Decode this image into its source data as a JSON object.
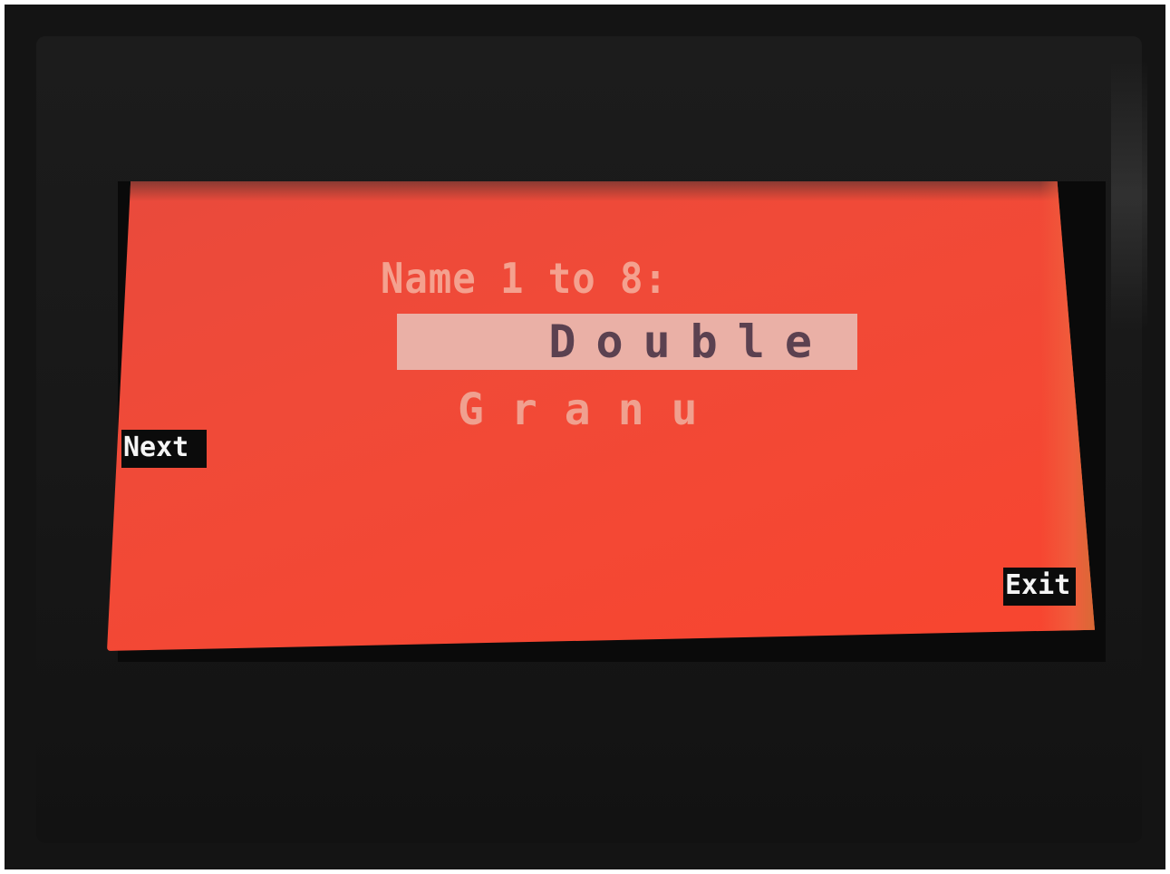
{
  "screen": {
    "prompt_label": "Name 1 to 8:",
    "name_value": "Double",
    "next_segment": "Granu",
    "softkey_left": "Next",
    "softkey_right": "Exit"
  },
  "colors": {
    "lcd_background": "#f04a38",
    "selected_field": "#eab0a6",
    "selected_text": "#5b4150",
    "dim_text": "#f4a18f",
    "softkey_background": "#0b0b0b",
    "softkey_text": "#f5f5f5",
    "device_body": "#141414"
  }
}
